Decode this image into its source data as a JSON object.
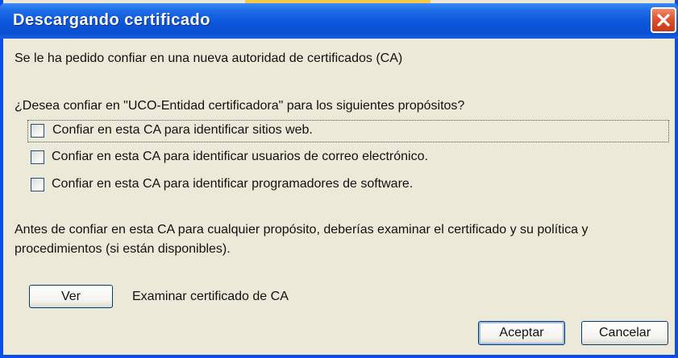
{
  "window": {
    "title": "Descargando certificado",
    "colors": {
      "titlebar": "#0b55da",
      "client": "#ece9d8",
      "close": "#e0532f"
    }
  },
  "dialog": {
    "intro": "Se le ha pedido confiar en una nueva autoridad de certificados (CA)",
    "question": "¿Desea confiar en \"UCO-Entidad certificadora\" para los siguientes propósitos?",
    "options": [
      {
        "label": "Confiar en esta CA para identificar sitios web.",
        "checked": false
      },
      {
        "label": "Confiar en esta CA para identificar usuarios de correo electrónico.",
        "checked": false
      },
      {
        "label": "Confiar en esta CA para identificar programadores de software.",
        "checked": false
      }
    ],
    "advice": "Antes de confiar en esta CA para cualquier propósito, deberías examinar el certificado y su política y procedimientos (si están disponibles).",
    "view_button": "Ver",
    "view_description": "Examinar certificado de CA",
    "ok_button": "Aceptar",
    "cancel_button": "Cancelar"
  },
  "icons": {
    "close": "close-icon",
    "checkbox": "checkbox-icon"
  }
}
